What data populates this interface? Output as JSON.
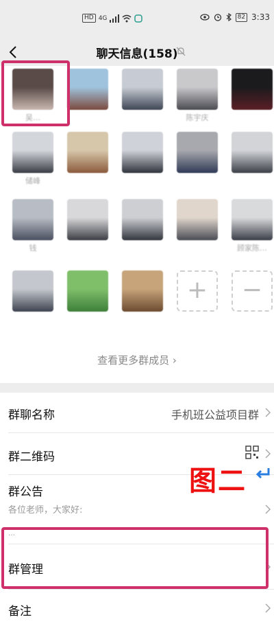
{
  "status_bar": {
    "hd_label": "HD",
    "network_label": "4G",
    "battery": "82",
    "time": "3:33"
  },
  "header": {
    "title": "聊天信息(158)"
  },
  "members": [
    {
      "name": "吴…",
      "color_a": "#5a4a48",
      "color_b": "#c9b8b0"
    },
    {
      "name": "",
      "color_a": "#9fc3dd",
      "color_b": "#7c4a3e"
    },
    {
      "name": "",
      "color_a": "#c7ccd4",
      "color_b": "#3f4654"
    },
    {
      "name": "陈宇庆",
      "color_a": "#c9c9cc",
      "color_b": "#4b4b52"
    },
    {
      "name": "",
      "color_a": "#1b1b1e",
      "color_b": "#5b1f26"
    },
    {
      "name": "储峰",
      "color_a": "#d3d6db",
      "color_b": "#3a3d45"
    },
    {
      "name": "",
      "color_a": "#d7c7aa",
      "color_b": "#8b5a3c"
    },
    {
      "name": "",
      "color_a": "#cfd2d8",
      "color_b": "#2f333c"
    },
    {
      "name": "",
      "color_a": "#a8a9ae",
      "color_b": "#2f3a55"
    },
    {
      "name": "",
      "color_a": "#d2d4d8",
      "color_b": "#3b3f47"
    },
    {
      "name": "钱",
      "color_a": "#b8bcc4",
      "color_b": "#4a5060"
    },
    {
      "name": "",
      "color_a": "#d8d8da",
      "color_b": "#3c3d44"
    },
    {
      "name": "",
      "color_a": "#cdcfd3",
      "color_b": "#33363e"
    },
    {
      "name": "",
      "color_a": "#e0d6cc",
      "color_b": "#4a4c55"
    },
    {
      "name": "顾家陈…",
      "color_a": "#d9dadc",
      "color_b": "#3a3e48"
    },
    {
      "name": "",
      "color_a": "#c4c7cd",
      "color_b": "#3e4350"
    },
    {
      "name": "",
      "color_a": "#7fbf6a",
      "color_b": "#3e7f3a"
    },
    {
      "name": "",
      "color_a": "#c8a47a",
      "color_b": "#6b4a30"
    }
  ],
  "add_tile": "+",
  "remove_tile": "−",
  "more_link": "查看更多群成员 ›",
  "settings": {
    "group_name_label": "群聊名称",
    "group_name_value": "手机班公益项目群",
    "qr_label": "群二维码",
    "notice_label": "群公告",
    "notice_preview": "各位老师，大家好:",
    "notice_more": "…",
    "manage_label": "群管理",
    "remark_label": "备注"
  },
  "annotation": {
    "stamp": "图二",
    "highlight_color": "#d0306a",
    "stamp_color": "#ee1111",
    "arrow_color": "#2a7de1"
  }
}
